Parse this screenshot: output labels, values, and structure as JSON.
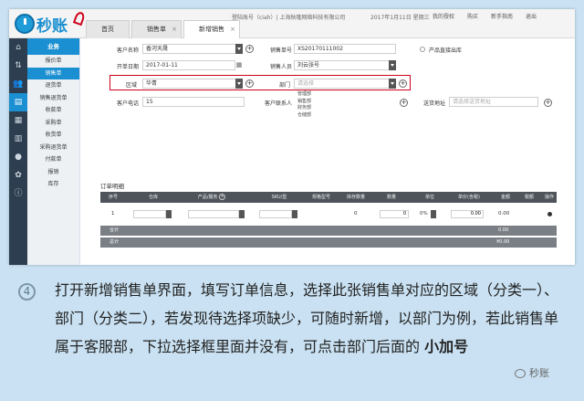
{
  "logo": {
    "text": "秒账"
  },
  "tabs": [
    {
      "label": "首页",
      "closable": false,
      "active": false
    },
    {
      "label": "销售单",
      "closable": true,
      "active": false
    },
    {
      "label": "新增销售",
      "closable": true,
      "active": true
    }
  ],
  "header": {
    "account": "登陆账号（ciah）| 上海秋隆网络科技有限公司",
    "date": "2017年1月11日 星期三",
    "tools": [
      "我的授权",
      "购买",
      "新手指南",
      "退出"
    ]
  },
  "sidebar_icons": [
    "home-icon",
    "transfer-icon",
    "users-icon",
    "document-icon",
    "grid-icon",
    "bar-chart-icon",
    "user-icon",
    "settings-icon",
    "info-icon"
  ],
  "menu": {
    "header": "业务",
    "items": [
      "报价单",
      "销售单",
      "退货单",
      "销售退货单",
      "收款单",
      "采购单",
      "收货单",
      "采购退货单",
      "付款单",
      "报销",
      "库存"
    ],
    "active_index": 1
  },
  "form": {
    "customer_name_label": "客户名称",
    "customer_name_value": "香河天晟",
    "order_no_label": "销售单号",
    "order_no_value": "XS20170111002",
    "direct_out_label": "产品直接出库",
    "date_label": "开单日期",
    "date_value": "2017-01-11",
    "sales_person_label": "销售人员",
    "sales_person_value": "刘云张号",
    "region_label": "区域",
    "region_value": "华青",
    "dept_label": "部门",
    "dept_placeholder": "请选择",
    "dept_options": [
      "管理部",
      "销售部",
      "财务部",
      "仓储部"
    ],
    "customer_phone_label": "客户电话",
    "customer_phone_value": "15",
    "customer_contact_label": "客户联系人",
    "ship_addr_label": "送货地址",
    "ship_addr_placeholder": "请选择送货地址"
  },
  "order": {
    "title": "订单明细",
    "columns": [
      "序号",
      "仓库",
      "产品/服务",
      "SKU/型",
      "规格型号",
      "库存数量",
      "数量",
      "单位",
      "单价(含税)",
      "金额",
      "税额",
      "操作"
    ],
    "row": {
      "index": "1",
      "stock": "0",
      "qty": "0",
      "tax_rate": "0%",
      "unit_price": "0.00",
      "amount": "0.00"
    },
    "subtotal_label": "合计",
    "subtotal_value": "0.00",
    "total_label": "总计",
    "total_value": "¥0.00"
  },
  "instruction": {
    "step": "4",
    "text": "打开新增销售单界面，填写订单信息，选择此张销售单对应的区域（分类一）、部门（分类二），若发现待选择项缺少，可随时新增，以部门为例，若此销售单属于客服部，下拉选择框里面并没有，可点击部门后面的",
    "emphasis": "小加号"
  },
  "watermark": "秒账"
}
